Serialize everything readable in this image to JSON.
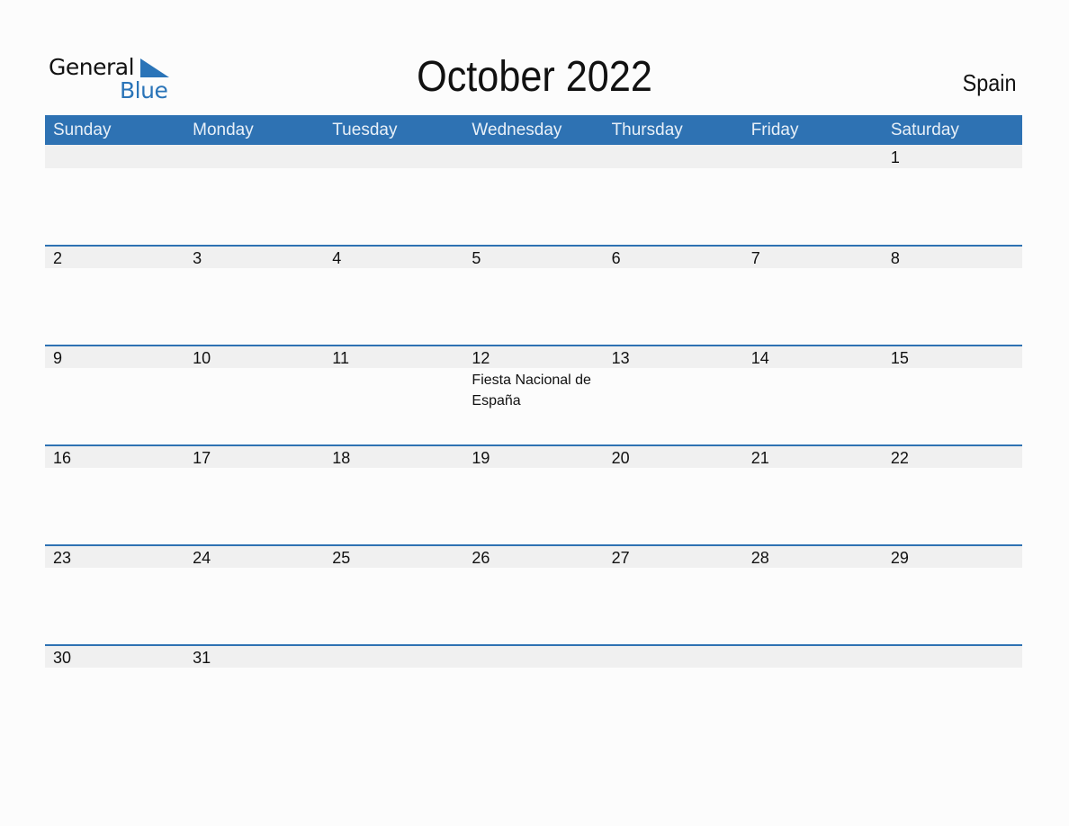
{
  "logo": {
    "general": "General",
    "blue": "Blue"
  },
  "title": "October 2022",
  "country": "Spain",
  "colors": {
    "accent": "#2e72b3",
    "strip": "#f0f0f0"
  },
  "weekdays": [
    "Sunday",
    "Monday",
    "Tuesday",
    "Wednesday",
    "Thursday",
    "Friday",
    "Saturday"
  ],
  "weeks": [
    [
      {
        "day": ""
      },
      {
        "day": ""
      },
      {
        "day": ""
      },
      {
        "day": ""
      },
      {
        "day": ""
      },
      {
        "day": ""
      },
      {
        "day": "1"
      }
    ],
    [
      {
        "day": "2"
      },
      {
        "day": "3"
      },
      {
        "day": "4"
      },
      {
        "day": "5"
      },
      {
        "day": "6"
      },
      {
        "day": "7"
      },
      {
        "day": "8"
      }
    ],
    [
      {
        "day": "9"
      },
      {
        "day": "10"
      },
      {
        "day": "11"
      },
      {
        "day": "12",
        "event": "Fiesta Nacional de España"
      },
      {
        "day": "13"
      },
      {
        "day": "14"
      },
      {
        "day": "15"
      }
    ],
    [
      {
        "day": "16"
      },
      {
        "day": "17"
      },
      {
        "day": "18"
      },
      {
        "day": "19"
      },
      {
        "day": "20"
      },
      {
        "day": "21"
      },
      {
        "day": "22"
      }
    ],
    [
      {
        "day": "23"
      },
      {
        "day": "24"
      },
      {
        "day": "25"
      },
      {
        "day": "26"
      },
      {
        "day": "27"
      },
      {
        "day": "28"
      },
      {
        "day": "29"
      }
    ],
    [
      {
        "day": "30"
      },
      {
        "day": "31"
      },
      {
        "day": ""
      },
      {
        "day": ""
      },
      {
        "day": ""
      },
      {
        "day": ""
      },
      {
        "day": ""
      }
    ]
  ]
}
